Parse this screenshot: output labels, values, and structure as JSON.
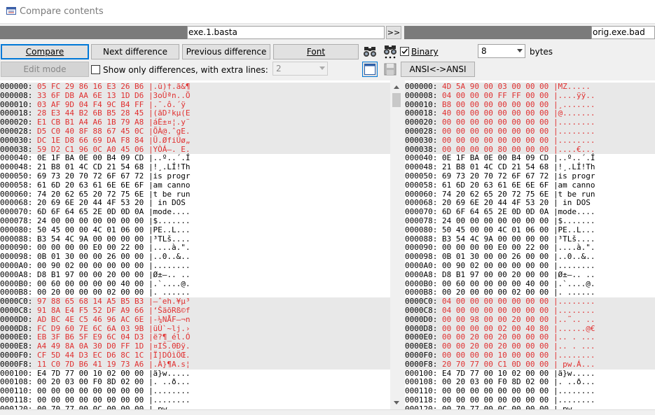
{
  "window": {
    "title": "Compare contents"
  },
  "paths": {
    "left": "exe.1.basta",
    "swap_label": ">>",
    "right": "orig.exe.bad"
  },
  "toolbar": {
    "compare": "Compare",
    "next_difference": "Next difference",
    "previous_difference": "Previous difference",
    "font": "Font",
    "binary_label": "Binary",
    "binary_checked": true,
    "bytes_value": "8",
    "bytes_label": "bytes",
    "edit_mode": "Edit mode",
    "show_only_label": "Show only differences, with extra lines:",
    "show_only_checked": false,
    "extra_lines_value": "2",
    "encoding": "ANSI<->ANSI"
  },
  "left_rows": [
    {
      "addr": "000000:",
      "hex": "05 FC 29 86 16 E3 26 B6",
      "text": "|.ü)†.ã&¶",
      "diff": true
    },
    {
      "addr": "000008:",
      "hex": "33 6F DB AA 6E 13 1D D6",
      "text": "|3oÛªn..Ö",
      "diff": true
    },
    {
      "addr": "000010:",
      "hex": "03 AF 9D 04 F4 9C B4 FF",
      "text": "|.¯.ô.´ÿ",
      "diff": true
    },
    {
      "addr": "000018:",
      "hex": "28 E3 44 B2 6B B5 28 45",
      "text": "|(ãD²kµ(E",
      "diff": true
    },
    {
      "addr": "000020:",
      "hex": "E1 CB B1 A4 A6 1B 79 A8",
      "text": "|áË±¤¦.y¨",
      "diff": true
    },
    {
      "addr": "000028:",
      "hex": "D5 C0 40 8F 88 67 45 0C",
      "text": "|ÕÀ@.ˆgE.",
      "diff": true
    },
    {
      "addr": "000030:",
      "hex": "DC 1E D8 66 69 DA F8 84",
      "text": "|Ü.ØfiÚø„",
      "diff": true
    },
    {
      "addr": "000038:",
      "hex": "59 D2 C1 96 0C A0 45 06",
      "text": "|YÒÁ–. E.",
      "diff": true
    },
    {
      "addr": "000040:",
      "hex": "0E 1F BA 0E 00 B4 09 CD",
      "text": "|..º..´.Í",
      "diff": false
    },
    {
      "addr": "000048:",
      "hex": "21 B8 01 4C CD 21 54 68",
      "text": "|!¸.LÍ!Th",
      "diff": false
    },
    {
      "addr": "000050:",
      "hex": "69 73 20 70 72 6F 67 72",
      "text": "|is progr",
      "diff": false
    },
    {
      "addr": "000058:",
      "hex": "61 6D 20 63 61 6E 6E 6F",
      "text": "|am canno",
      "diff": false
    },
    {
      "addr": "000060:",
      "hex": "74 20 62 65 20 72 75 6E",
      "text": "|t be run",
      "diff": false
    },
    {
      "addr": "000068:",
      "hex": "20 69 6E 20 44 4F 53 20",
      "text": "| in DOS ",
      "diff": false
    },
    {
      "addr": "000070:",
      "hex": "6D 6F 64 65 2E 0D 0D 0A",
      "text": "|mode....",
      "diff": false
    },
    {
      "addr": "000078:",
      "hex": "24 00 00 00 00 00 00 00",
      "text": "|$.......",
      "diff": false
    },
    {
      "addr": "000080:",
      "hex": "50 45 00 00 4C 01 06 00",
      "text": "|PE..L...",
      "diff": false
    },
    {
      "addr": "000088:",
      "hex": "B3 54 4C 9A 00 00 00 00",
      "text": "|³TLš....",
      "diff": false
    },
    {
      "addr": "000090:",
      "hex": "00 00 00 00 E0 00 22 00",
      "text": "|....à.\".",
      "diff": false
    },
    {
      "addr": "000098:",
      "hex": "0B 01 30 00 00 26 00 00",
      "text": "|..0..&..",
      "diff": false
    },
    {
      "addr": "0000A0:",
      "hex": "00 90 02 00 00 00 00 00",
      "text": "|........",
      "diff": false
    },
    {
      "addr": "0000A8:",
      "hex": "D8 B1 97 00 00 20 00 00",
      "text": "|Ø±—.. ..",
      "diff": false
    },
    {
      "addr": "0000B0:",
      "hex": "00 60 00 00 00 00 40 00",
      "text": "|.`....@.",
      "diff": false
    },
    {
      "addr": "0000B8:",
      "hex": "00 20 00 00 00 02 00 00",
      "text": "|. ......",
      "diff": false
    },
    {
      "addr": "0000C0:",
      "hex": "97 88 65 68 14 A5 B5 B3",
      "text": "|—ˆeh.¥µ³",
      "diff": true
    },
    {
      "addr": "0000C8:",
      "hex": "91 8A E4 F5 52 DF A9 66",
      "text": "|‘ŠäõRß©f",
      "diff": true
    },
    {
      "addr": "0000D0:",
      "hex": "AD BC 4E C5 46 96 AC 6E",
      "text": "|-¼NÅF–¬n",
      "diff": true
    },
    {
      "addr": "0000D8:",
      "hex": "FC D9 60 7E 6C 6A 03 9B",
      "text": "|üÙ`~lj.›",
      "diff": true
    },
    {
      "addr": "0000E0:",
      "hex": "EB 3F B6 5F E9 6C 04 D3",
      "text": "|ë?¶_él.Ó",
      "diff": true
    },
    {
      "addr": "0000E8:",
      "hex": "A4 49 8A 0A 30 D0 FF 1D",
      "text": "|¤IŠ.0Ðÿ.",
      "diff": true
    },
    {
      "addr": "0000F0:",
      "hex": "CF 5D 44 D3 EC D6 8C 1C",
      "text": "|Ï]DÓìÖŒ.",
      "diff": true
    },
    {
      "addr": "0000F8:",
      "hex": "11 C0 7D B6 41 19 73 A6",
      "text": "|.À}¶A.s¦",
      "diff": true
    },
    {
      "addr": "000100:",
      "hex": "E4 7D 77 00 10 02 00 00",
      "text": "|ä}w.....",
      "diff": false
    },
    {
      "addr": "000108:",
      "hex": "00 20 03 00 F0 8D 02 00",
      "text": "|. ..ð...",
      "diff": false
    },
    {
      "addr": "000110:",
      "hex": "00 00 00 00 00 00 00 00",
      "text": "|........",
      "diff": false
    },
    {
      "addr": "000118:",
      "hex": "00 00 00 00 00 00 00 00",
      "text": "|........",
      "diff": false
    },
    {
      "addr": "000120:",
      "hex": "00 70 77 00 0C 00 00 00",
      "text": "|.pw.....",
      "diff": false
    }
  ],
  "right_rows": [
    {
      "addr": "000000:",
      "hex": "4D 5A 90 00 03 00 00 00",
      "text": "|MZ.....",
      "diff": true
    },
    {
      "addr": "000008:",
      "hex": "04 00 00 00 FF FF 00 00",
      "text": "|....ÿÿ..",
      "diff": true
    },
    {
      "addr": "000010:",
      "hex": "B8 00 00 00 00 00 00 00",
      "text": "|¸.......",
      "diff": true
    },
    {
      "addr": "000018:",
      "hex": "40 00 00 00 00 00 00 00",
      "text": "|@.......",
      "diff": true
    },
    {
      "addr": "000020:",
      "hex": "00 00 00 00 00 00 00 00",
      "text": "|........",
      "diff": true
    },
    {
      "addr": "000028:",
      "hex": "00 00 00 00 00 00 00 00",
      "text": "|........",
      "diff": true
    },
    {
      "addr": "000030:",
      "hex": "00 00 00 00 00 00 00 00",
      "text": "|........",
      "diff": true
    },
    {
      "addr": "000038:",
      "hex": "00 00 00 00 80 00 00 00",
      "text": "|....€...",
      "diff": true
    },
    {
      "addr": "000040:",
      "hex": "0E 1F BA 0E 00 B4 09 CD",
      "text": "|..º..´.Í",
      "diff": false
    },
    {
      "addr": "000048:",
      "hex": "21 B8 01 4C CD 21 54 68",
      "text": "|!¸.LÍ!Th",
      "diff": false
    },
    {
      "addr": "000050:",
      "hex": "69 73 20 70 72 6F 67 72",
      "text": "|is progr",
      "diff": false
    },
    {
      "addr": "000058:",
      "hex": "61 6D 20 63 61 6E 6E 6F",
      "text": "|am canno",
      "diff": false
    },
    {
      "addr": "000060:",
      "hex": "74 20 62 65 20 72 75 6E",
      "text": "|t be run",
      "diff": false
    },
    {
      "addr": "000068:",
      "hex": "20 69 6E 20 44 4F 53 20",
      "text": "| in DOS ",
      "diff": false
    },
    {
      "addr": "000070:",
      "hex": "6D 6F 64 65 2E 0D 0D 0A",
      "text": "|mode....",
      "diff": false
    },
    {
      "addr": "000078:",
      "hex": "24 00 00 00 00 00 00 00",
      "text": "|$.......",
      "diff": false
    },
    {
      "addr": "000080:",
      "hex": "50 45 00 00 4C 01 06 00",
      "text": "|PE..L...",
      "diff": false
    },
    {
      "addr": "000088:",
      "hex": "B3 54 4C 9A 00 00 00 00",
      "text": "|³TLš....",
      "diff": false
    },
    {
      "addr": "000090:",
      "hex": "00 00 00 00 E0 00 22 00",
      "text": "|....à.\".",
      "diff": false
    },
    {
      "addr": "000098:",
      "hex": "0B 01 30 00 00 26 00 00",
      "text": "|..0..&..",
      "diff": false
    },
    {
      "addr": "0000A0:",
      "hex": "00 90 02 00 00 00 00 00",
      "text": "|........",
      "diff": false
    },
    {
      "addr": "0000A8:",
      "hex": "D8 B1 97 00 00 20 00 00",
      "text": "|Ø±—.. ..",
      "diff": false
    },
    {
      "addr": "0000B0:",
      "hex": "00 60 00 00 00 00 40 00",
      "text": "|.`....@.",
      "diff": false
    },
    {
      "addr": "0000B8:",
      "hex": "00 20 00 00 00 02 00 00",
      "text": "|. ......",
      "diff": false
    },
    {
      "addr": "0000C0:",
      "hex": "04 00 00 00 00 00 00 00",
      "text": "|........",
      "diff": true
    },
    {
      "addr": "0000C8:",
      "hex": "04 00 00 00 00 00 00 00",
      "text": "|........",
      "diff": true
    },
    {
      "addr": "0000D0:",
      "hex": "00 00 98 00 00 20 00 00",
      "text": "|..˜.. ..",
      "diff": true
    },
    {
      "addr": "0000D8:",
      "hex": "00 00 00 00 02 00 40 80",
      "text": "|......@€",
      "diff": true
    },
    {
      "addr": "0000E0:",
      "hex": "00 00 20 00 20 00 00 00",
      "text": "|.. . ...",
      "diff": true
    },
    {
      "addr": "0000E8:",
      "hex": "00 00 20 00 20 00 00 00",
      "text": "|.. . ...",
      "diff": true
    },
    {
      "addr": "0000F0:",
      "hex": "00 00 00 00 10 00 00 00",
      "text": "|........",
      "diff": true
    },
    {
      "addr": "0000F8:",
      "hex": "20 70 77 00 C1 0D 00 00",
      "text": "| pw.Á...",
      "diff": true
    },
    {
      "addr": "000100:",
      "hex": "E4 7D 77 00 10 02 00 00",
      "text": "|ä}w.....",
      "diff": false
    },
    {
      "addr": "000108:",
      "hex": "00 20 03 00 F0 8D 02 00",
      "text": "|. ..ð...",
      "diff": false
    },
    {
      "addr": "000110:",
      "hex": "00 00 00 00 00 00 00 00",
      "text": "|........",
      "diff": false
    },
    {
      "addr": "000118:",
      "hex": "00 00 00 00 00 00 00 00",
      "text": "|........",
      "diff": false
    },
    {
      "addr": "000120:",
      "hex": "00 70 77 00 0C 00 00 00",
      "text": "|.pw.....",
      "diff": false
    }
  ],
  "colors": {
    "diff_text": "#e03030",
    "diff_row_bg": "#e8e8e8",
    "accent": "#0078d7"
  },
  "icons": [
    "compare-app-icon",
    "binoculars-icon",
    "binoculars-all-icon",
    "window-icon",
    "save-disk-icon"
  ]
}
